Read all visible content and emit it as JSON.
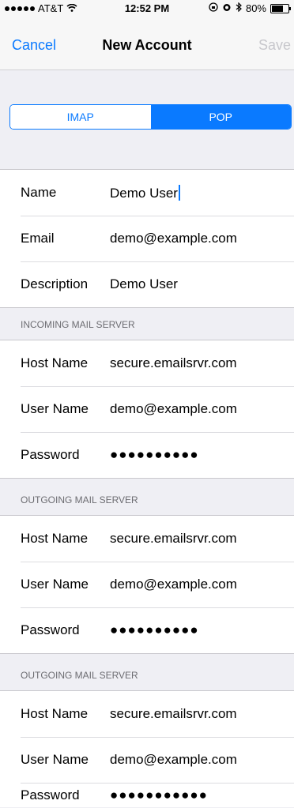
{
  "status_bar": {
    "carrier": "AT&T",
    "time": "12:52 PM",
    "battery": "80%",
    "battery_level": 0.8
  },
  "nav": {
    "cancel": "Cancel",
    "title": "New Account",
    "save": "Save"
  },
  "segmented": {
    "options": [
      "IMAP",
      "POP"
    ],
    "selected": "POP"
  },
  "account": {
    "name_label": "Name",
    "name_value": "Demo User",
    "email_label": "Email",
    "email_value": "demo@example.com",
    "description_label": "Description",
    "description_value": "Demo User"
  },
  "incoming": {
    "header": "INCOMING MAIL SERVER",
    "host_label": "Host Name",
    "host_value": "secure.emailsrvr.com",
    "user_label": "User Name",
    "user_value": "demo@example.com",
    "password_label": "Password",
    "password_value": "●●●●●●●●●●"
  },
  "outgoing1": {
    "header": "OUTGOING MAIL SERVER",
    "host_label": "Host Name",
    "host_value": "secure.emailsrvr.com",
    "user_label": "User Name",
    "user_value": "demo@example.com",
    "password_label": "Password",
    "password_value": "●●●●●●●●●●"
  },
  "outgoing2": {
    "header": "OUTGOING MAIL SERVER",
    "host_label": "Host Name",
    "host_value": "secure.emailsrvr.com",
    "user_label": "User Name",
    "user_value": "demo@example.com",
    "password_label": "Password",
    "password_value": "●●●●●●●●●●●"
  }
}
